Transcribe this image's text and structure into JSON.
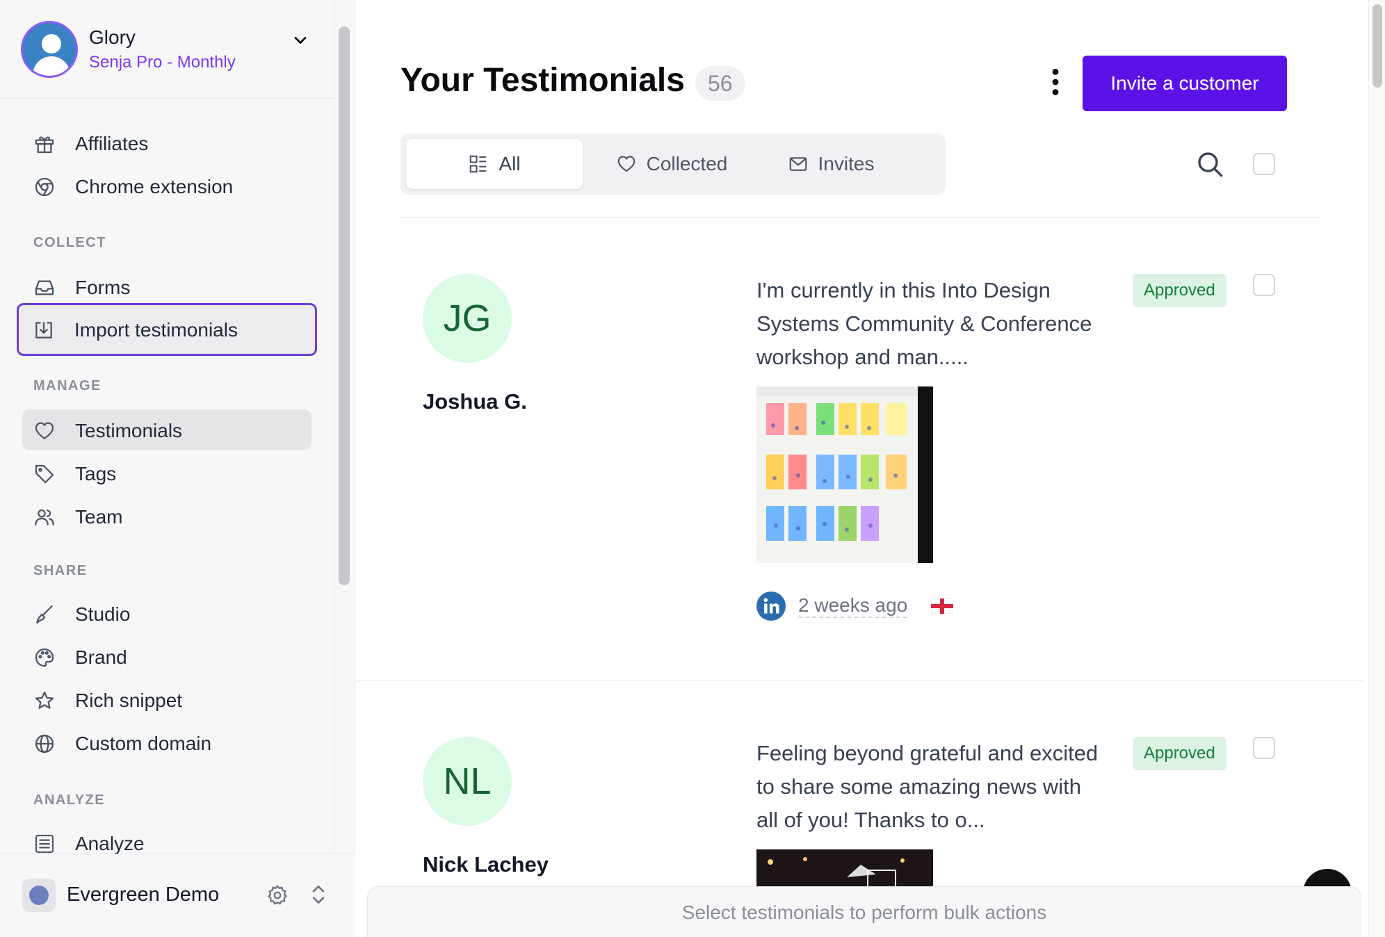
{
  "account": {
    "name": "Glory",
    "plan": "Senja Pro - Monthly"
  },
  "sidebar": {
    "top_items": [
      {
        "label": "Affiliates",
        "icon": "gift-icon"
      },
      {
        "label": "Chrome extension",
        "icon": "chrome-icon"
      }
    ],
    "sections": [
      {
        "title": "COLLECT",
        "items": [
          {
            "label": "Forms",
            "icon": "inbox-icon"
          },
          {
            "label": "Import testimonials",
            "icon": "import-icon",
            "state": "focused"
          }
        ]
      },
      {
        "title": "MANAGE",
        "items": [
          {
            "label": "Testimonials",
            "icon": "heart-icon",
            "state": "active"
          },
          {
            "label": "Tags",
            "icon": "tag-icon"
          },
          {
            "label": "Team",
            "icon": "users-icon"
          }
        ]
      },
      {
        "title": "SHARE",
        "items": [
          {
            "label": "Studio",
            "icon": "brush-icon"
          },
          {
            "label": "Brand",
            "icon": "palette-icon"
          },
          {
            "label": "Rich snippet",
            "icon": "star-icon"
          },
          {
            "label": "Custom domain",
            "icon": "globe-icon"
          }
        ]
      },
      {
        "title": "ANALYZE",
        "items": [
          {
            "label": "Analyze",
            "icon": "list-icon"
          }
        ]
      }
    ]
  },
  "workspace": {
    "name": "Evergreen Demo"
  },
  "header": {
    "title": "Your Testimonials",
    "count": "56",
    "invite_label": "Invite a customer"
  },
  "tabs": [
    {
      "label": "All",
      "icon": "layout-icon",
      "active": true
    },
    {
      "label": "Collected",
      "icon": "heart-icon",
      "active": false
    },
    {
      "label": "Invites",
      "icon": "mail-icon",
      "active": false
    }
  ],
  "testimonials": [
    {
      "initials": "JG",
      "name": "Joshua G.",
      "text": "I'm currently in this Into Design Systems Community & Conference workshop and man.....",
      "status": "Approved",
      "source": "linkedin-icon",
      "time": "2 weeks ago",
      "flag": "england-flag"
    },
    {
      "initials": "NL",
      "name": "Nick Lachey",
      "text": "Feeling beyond grateful and excited to share some amazing news with all of you! Thanks to o...",
      "status": "Approved"
    }
  ],
  "bulk_bar": {
    "text": "Select testimonials to perform bulk actions"
  },
  "colors": {
    "accent": "#5b12e6",
    "approved_bg": "#dcf3e3",
    "approved_text": "#15803d",
    "focus_border": "#6d3fd4"
  }
}
